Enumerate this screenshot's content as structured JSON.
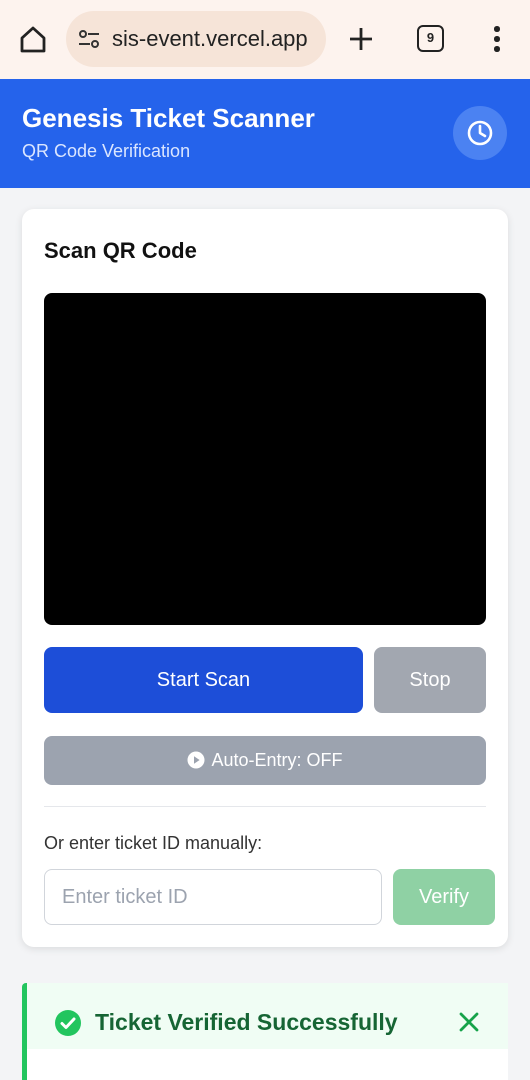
{
  "browser": {
    "url": "sis-event.vercel.app",
    "tab_count": "9"
  },
  "header": {
    "title": "Genesis Ticket Scanner",
    "subtitle": "QR Code Verification",
    "history_icon": "clock-icon"
  },
  "scanner": {
    "title": "Scan QR Code",
    "start_label": "Start Scan",
    "stop_label": "Stop",
    "auto_entry_label": "Auto-Entry: OFF",
    "manual_label": "Or enter ticket ID manually:",
    "ticket_placeholder": "Enter ticket ID",
    "ticket_value": "",
    "verify_label": "Verify"
  },
  "result": {
    "title": "Ticket Verified Successfully",
    "status_color": "#22c55e"
  },
  "colors": {
    "primary": "#2563eb",
    "start_button": "#1d4ed8",
    "disabled": "#9ca3af",
    "verify_disabled": "#8fd1a4",
    "success_text": "#166534"
  }
}
